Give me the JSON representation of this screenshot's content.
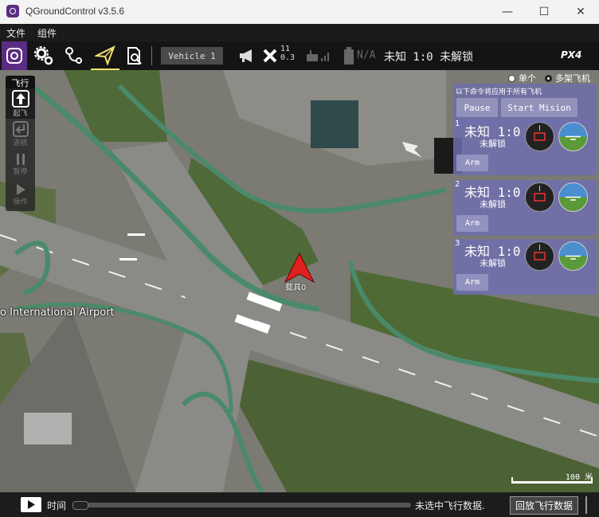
{
  "window": {
    "title": "QGroundControl v3.5.6",
    "minimize": "—",
    "maximize": "☐",
    "close": "✕"
  },
  "menu": {
    "file": "文件",
    "widgets": "组件"
  },
  "toolbar": {
    "vehicle_selector": "Vehicle 1",
    "gps_sat_count": "11",
    "gps_hdop": "0.3",
    "battery": "N/A",
    "status": "未知 1:0 未解锁",
    "firmware_logo": "PX4"
  },
  "fly_tools": {
    "header": "飞行",
    "takeoff": "起飞",
    "rtl": "返航",
    "pause": "暂停",
    "action": "操作"
  },
  "map": {
    "airport_label": "o International Airport",
    "vehicle_label": "载具0",
    "scale_text": "100 米"
  },
  "mode_select": {
    "single": "单个",
    "multi": "多架飞机",
    "selected": "multi"
  },
  "multi_vehicle": {
    "header": "以下命令将应用于所有飞机",
    "pause": "Pause",
    "start_mission": "Start Mision",
    "vehicles": [
      {
        "id": "1",
        "status": "未知 1:0",
        "arm_state": "未解锁",
        "arm_button": "Arm"
      },
      {
        "id": "2",
        "status": "未知 1:0",
        "arm_state": "未解锁",
        "arm_button": "Arm"
      },
      {
        "id": "3",
        "status": "未知 1:0",
        "arm_state": "未解锁",
        "arm_button": "Arm"
      }
    ]
  },
  "playback": {
    "time_label": "时间",
    "progress": 0,
    "no_file": "未选中飞行数据.",
    "replay_button": "回放飞行数据"
  }
}
